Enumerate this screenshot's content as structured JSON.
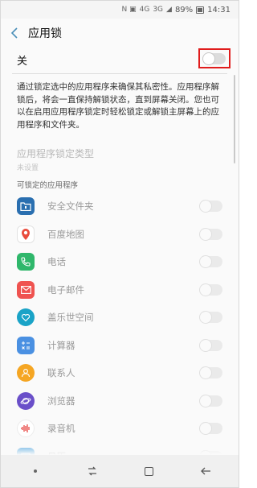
{
  "status_bar": {
    "icons_left": "N ▣",
    "network": "4G",
    "network2": "3G",
    "battery": "89%",
    "time": "14:31"
  },
  "header": {
    "title": "应用锁",
    "back_icon": "chevron-left-icon"
  },
  "master_switch": {
    "label": "关",
    "state": "off"
  },
  "description": "通过锁定选中的应用程序来确保其私密性。应用程序解锁后，将会一直保持解锁状态，直到屏幕关闭。您也可以在启用应用程序锁定时轻松锁定或解锁主屏幕上的应用程序和文件夹。",
  "lock_type": {
    "title": "应用程序锁定类型",
    "value": "未设置"
  },
  "apps_section_title": "可锁定的应用程序",
  "apps": [
    {
      "name": "安全文件夹",
      "icon": "secure-folder-icon",
      "color": "#2a6fb0",
      "state": "off"
    },
    {
      "name": "百度地图",
      "icon": "baidu-map-icon",
      "color": "#ffffff",
      "state": "off"
    },
    {
      "name": "电话",
      "icon": "phone-icon",
      "color": "#2fb76b",
      "state": "off"
    },
    {
      "name": "电子邮件",
      "icon": "email-icon",
      "color": "#ef5350",
      "state": "off"
    },
    {
      "name": "盖乐世空间",
      "icon": "galaxy-space-icon",
      "color": "#1aa3c7",
      "state": "off"
    },
    {
      "name": "计算器",
      "icon": "calculator-icon",
      "color": "#4a90e2",
      "state": "off"
    },
    {
      "name": "联系人",
      "icon": "contacts-icon",
      "color": "#f5a623",
      "state": "off"
    },
    {
      "name": "浏览器",
      "icon": "browser-icon",
      "color": "#6a4fc9",
      "state": "off"
    },
    {
      "name": "录音机",
      "icon": "voice-recorder-icon",
      "color": "#e53935",
      "state": "off"
    },
    {
      "name": "日历",
      "icon": "calendar-icon",
      "color": "#4aa3df",
      "state": "off"
    }
  ],
  "colors": {
    "accent": "#4a8fb8",
    "highlight_box": "#e01c1c"
  }
}
